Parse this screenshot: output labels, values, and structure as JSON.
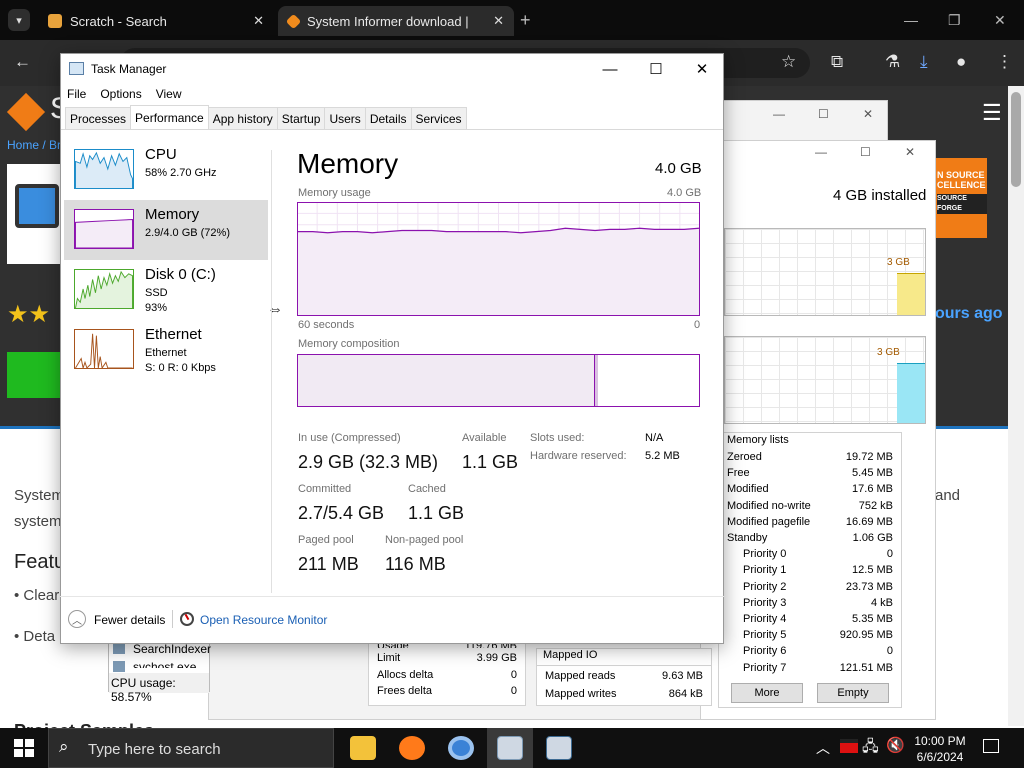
{
  "browser": {
    "tabs": [
      {
        "label": "Scratch - Search"
      },
      {
        "label": "System Informer download | So"
      }
    ],
    "new_tab": "+"
  },
  "site": {
    "breadcrumb": "Home / Br",
    "logo_letter": "S",
    "stars": "★★",
    "hours_ago": "ours ago",
    "installed_text": "4 GB installed",
    "badge_top": "N SOURCE",
    "badge_mid": "CELLENCE",
    "badge_bot": "SOURCE FORGE",
    "body_line1": "System",
    "body_line2": "system",
    "body_right": "and",
    "features": "Featu",
    "bullet1": "• Clear",
    "bullet2": "• Deta",
    "footer_heading": "Project Samples"
  },
  "bg_tm": {
    "graph1_label": "3 GB",
    "graph2_label": "3 GB",
    "usage_label": "Usage",
    "usage_value": "119.76 MB",
    "proc1": "SearchIndexer",
    "proc2": "svchost.exe",
    "cpu_usage": "CPU usage: 58.57%",
    "limit_label": "Limit",
    "limit_value": "3.99 GB",
    "allocs_label": "Allocs delta",
    "allocs_value": "0",
    "frees_label": "Frees delta",
    "frees_value": "0",
    "mapped_io": "Mapped IO",
    "mapped_reads_label": "Mapped reads",
    "mapped_reads_value": "9.63 MB",
    "mapped_writes_label": "Mapped writes",
    "mapped_writes_value": "864 kB",
    "memory_lists": {
      "title": "Memory lists",
      "rows": [
        {
          "label": "Zeroed",
          "value": "19.72 MB"
        },
        {
          "label": "Free",
          "value": "5.45 MB"
        },
        {
          "label": "Modified",
          "value": "17.6 MB"
        },
        {
          "label": "Modified no-write",
          "value": "752 kB"
        },
        {
          "label": "Modified pagefile",
          "value": "16.69 MB"
        },
        {
          "label": "Standby",
          "value": "1.06 GB"
        },
        {
          "label": "Priority 0",
          "value": "0"
        },
        {
          "label": "Priority 1",
          "value": "12.5 MB"
        },
        {
          "label": "Priority 2",
          "value": "23.73 MB"
        },
        {
          "label": "Priority 3",
          "value": "4 kB"
        },
        {
          "label": "Priority 4",
          "value": "5.35 MB"
        },
        {
          "label": "Priority 5",
          "value": "920.95 MB"
        },
        {
          "label": "Priority 6",
          "value": "0"
        },
        {
          "label": "Priority 7",
          "value": "121.51 MB"
        }
      ],
      "more": "More",
      "empty": "Empty"
    }
  },
  "tm": {
    "title": "Task Manager",
    "menu": [
      "File",
      "Options",
      "View"
    ],
    "tabs": [
      "Processes",
      "Performance",
      "App history",
      "Startup",
      "Users",
      "Details",
      "Services"
    ],
    "resources": [
      {
        "name": "CPU",
        "sub1": "58% 2.70 GHz",
        "sub2": ""
      },
      {
        "name": "Memory",
        "sub1": "2.9/4.0 GB (72%)",
        "sub2": ""
      },
      {
        "name": "Disk 0 (C:)",
        "sub1": "SSD",
        "sub2": "93%"
      },
      {
        "name": "Ethernet",
        "sub1": "Ethernet",
        "sub2": "S: 0 R: 0 Kbps"
      }
    ],
    "panel": {
      "title": "Memory",
      "total": "4.0 GB",
      "usage_label": "Memory usage",
      "usage_max": "4.0 GB",
      "seconds": "60 seconds",
      "zero": "0",
      "composition_label": "Memory composition",
      "in_use_label": "In use (Compressed)",
      "in_use_value": "2.9 GB (32.3 MB)",
      "available_label": "Available",
      "available_value": "1.1 GB",
      "slots_label": "Slots used:",
      "slots_value": "N/A",
      "hw_label": "Hardware reserved:",
      "hw_value": "5.2 MB",
      "committed_label": "Committed",
      "committed_value": "2.7/5.4 GB",
      "cached_label": "Cached",
      "cached_value": "1.1 GB",
      "paged_label": "Paged pool",
      "paged_value": "211 MB",
      "nonpaged_label": "Non-paged pool",
      "nonpaged_value": "116 MB",
      "usage_history_pct": [
        74,
        74,
        73,
        74,
        74,
        73,
        74,
        75,
        75,
        75,
        74,
        74,
        74,
        74,
        74,
        73,
        74,
        75,
        77,
        76,
        75,
        76,
        76,
        77,
        76,
        76,
        76,
        77
      ],
      "composition_in_use_pct": 74
    },
    "fewer_details": "Fewer details",
    "open_monitor": "Open Resource Monitor"
  },
  "taskbar": {
    "search_placeholder": "Type here to search",
    "time": "10:00 PM",
    "date": "6/6/2024"
  },
  "colors": {
    "memory": "#8b12ae",
    "cpu": "#1b8cc9",
    "disk": "#4ca82c",
    "ethernet": "#a7541d",
    "accent": "#1e73be"
  }
}
